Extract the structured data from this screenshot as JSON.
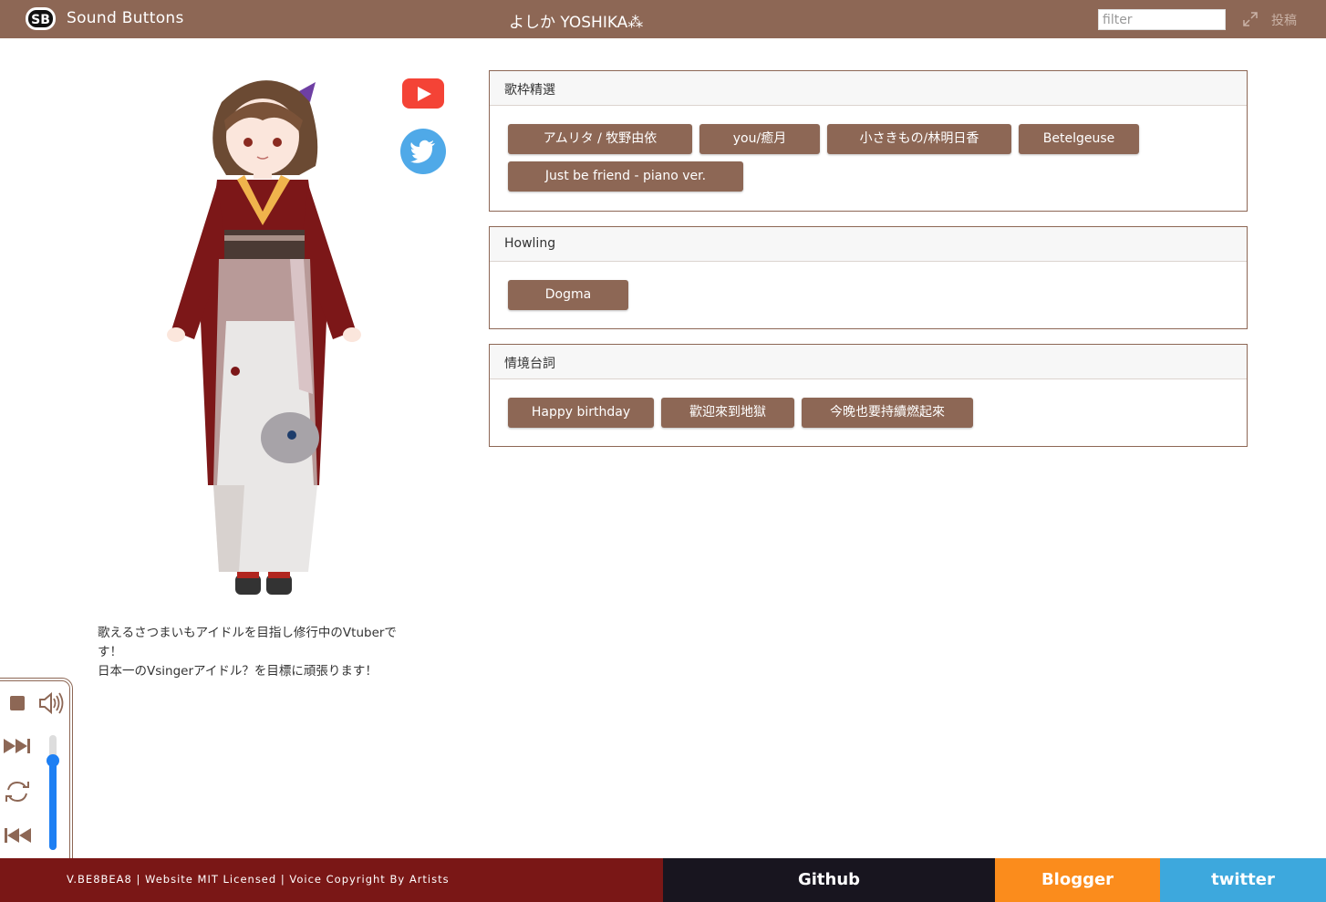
{
  "header": {
    "brand": "Sound Buttons",
    "vtuber_title": "よしか YOSHIKA⁂",
    "filter_placeholder": "filter",
    "post_label": "投稿",
    "bg_color": "#8d6755"
  },
  "profile": {
    "description_line1": "歌えるさつまいもアイドルを目指し修行中のVtuberで",
    "description_line2": "す！",
    "description_line3": "日本一のVsingerアイドル？を目標に頑張ります！",
    "links": [
      "youtube-icon",
      "twitter-icon"
    ]
  },
  "sections": [
    {
      "title": "歌枠精選",
      "buttons": [
        "アムリタ / 牧野由依",
        "you/癒月",
        "小さきもの/林明日香",
        "Betelgeuse",
        "Just be friend - piano ver."
      ]
    },
    {
      "title": "Howling",
      "buttons": [
        "Dogma"
      ]
    },
    {
      "title": "情境台詞",
      "buttons": [
        "Happy birthday",
        "歡迎來到地獄",
        "今晚也要持續燃起來"
      ]
    }
  ],
  "player": {
    "controls": [
      "stop-icon",
      "volume-icon",
      "next-icon",
      "repeat-icon",
      "previous-icon"
    ],
    "volume_level": 0.78
  },
  "footer": {
    "version_text": "V.BE8BEA8 | Website MIT Licensed | Voice Copyright By Artists",
    "github": "Github",
    "blogger": "Blogger",
    "twitter": "twitter"
  }
}
